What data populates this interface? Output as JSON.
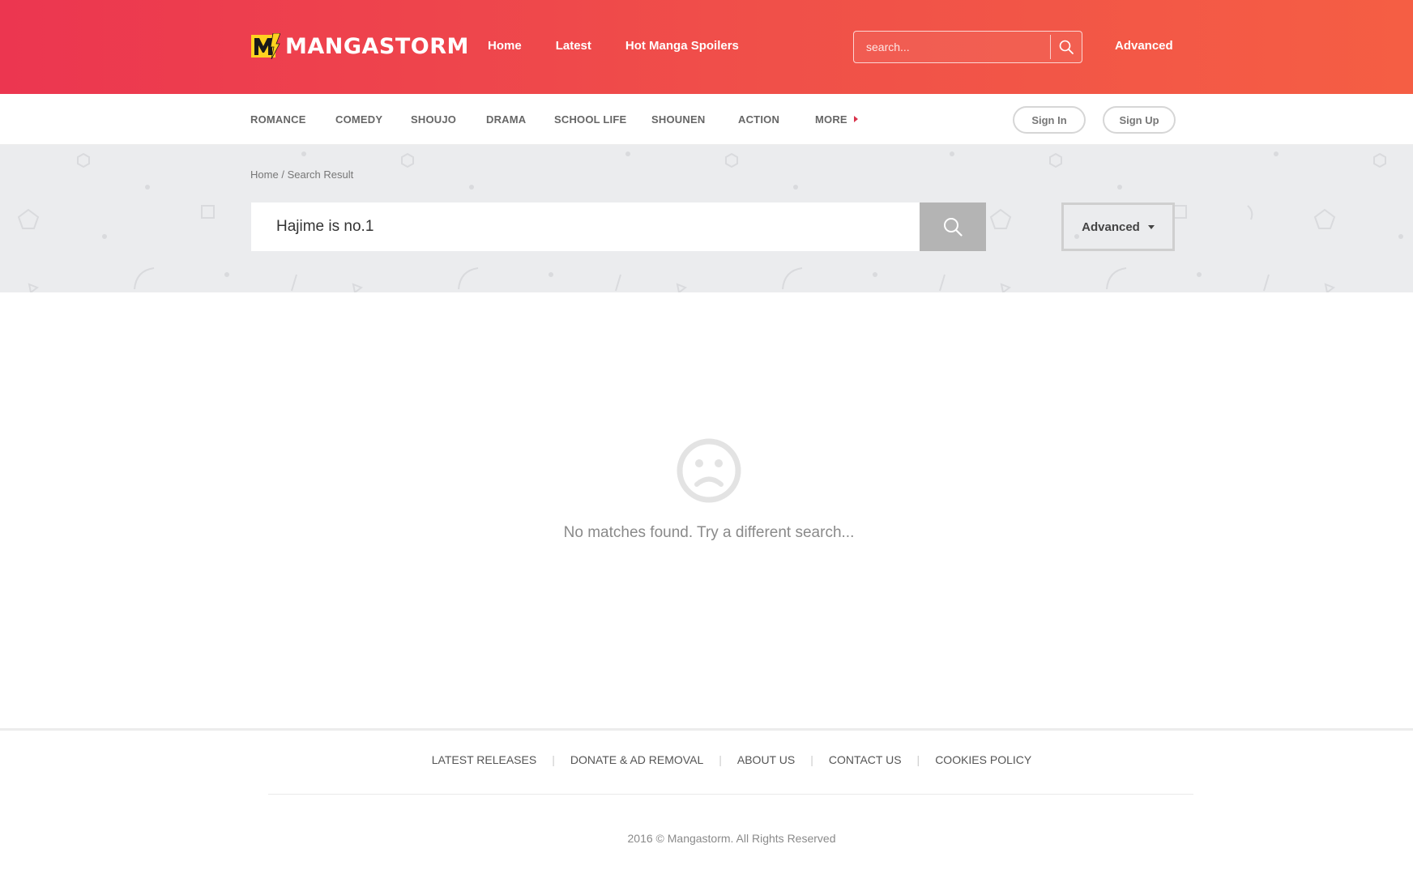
{
  "brand": {
    "name": "MANGASTORM",
    "logo_icon": "m-bolt-logo",
    "accent_color": "#ec3650",
    "accent_color_end": "#f55e44",
    "logo_yellow": "#ffd21f"
  },
  "topnav": {
    "links": [
      {
        "label": "Home"
      },
      {
        "label": "Latest"
      },
      {
        "label": "Hot Manga Spoilers"
      }
    ],
    "search_placeholder": "search...",
    "search_icon": "search-icon",
    "advanced_label": "Advanced"
  },
  "categories": {
    "items": [
      {
        "label": "ROMANCE"
      },
      {
        "label": "COMEDY"
      },
      {
        "label": "SHOUJO"
      },
      {
        "label": "DRAMA"
      },
      {
        "label": "SCHOOL LIFE"
      },
      {
        "label": "SHOUNEN"
      },
      {
        "label": "ACTION"
      }
    ],
    "more_label": "MORE",
    "sign_in_label": "Sign In",
    "sign_up_label": "Sign Up"
  },
  "breadcrumb": {
    "home": "Home",
    "separator": "/",
    "current": "Search Result"
  },
  "search": {
    "query": "Hajime is no.1",
    "advanced_label": "Advanced"
  },
  "results": {
    "empty_icon": "sad-face-icon",
    "message": "No matches found. Try a different search..."
  },
  "footer": {
    "links": [
      {
        "label": "LATEST RELEASES"
      },
      {
        "label": "DONATE & AD REMOVAL"
      },
      {
        "label": "ABOUT US"
      },
      {
        "label": "CONTACT US"
      },
      {
        "label": "COOKIES POLICY"
      }
    ],
    "separator": "|",
    "copyright": "2016 © Mangastorm. All Rights Reserved"
  }
}
